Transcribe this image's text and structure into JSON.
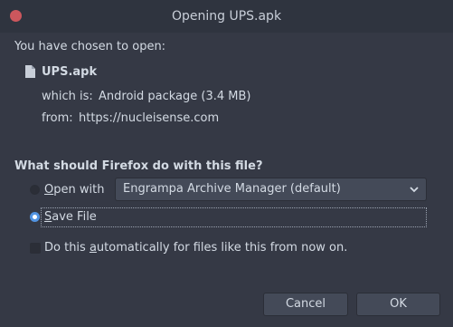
{
  "window": {
    "title": "Opening UPS.apk"
  },
  "intro": {
    "chosen_label": "You have chosen to open:"
  },
  "file": {
    "name": "UPS.apk",
    "type_label": "which is:",
    "type_value": "Android package (3.4 MB)",
    "from_label": "from:",
    "from_value": "https://nucleisense.com",
    "icon": "document-icon"
  },
  "question": {
    "heading": "What should Firefox do with this file?"
  },
  "options": {
    "open_with": {
      "accel": "O",
      "rest": "pen with",
      "selected": false
    },
    "application_select": {
      "value": "Engrampa Archive Manager (default)"
    },
    "save_file": {
      "accel": "S",
      "rest": "ave File",
      "selected": true
    },
    "auto": {
      "prefix": "Do this ",
      "accel": "a",
      "suffix": "utomatically for files like this from now on.",
      "checked": false
    }
  },
  "buttons": {
    "cancel_label": "Cancel",
    "ok_label": "OK"
  },
  "colors": {
    "background": "#353945",
    "titlebar": "#2f343f",
    "accent": "#5294e2",
    "close": "#cc575d",
    "text": "#d3dae3"
  }
}
